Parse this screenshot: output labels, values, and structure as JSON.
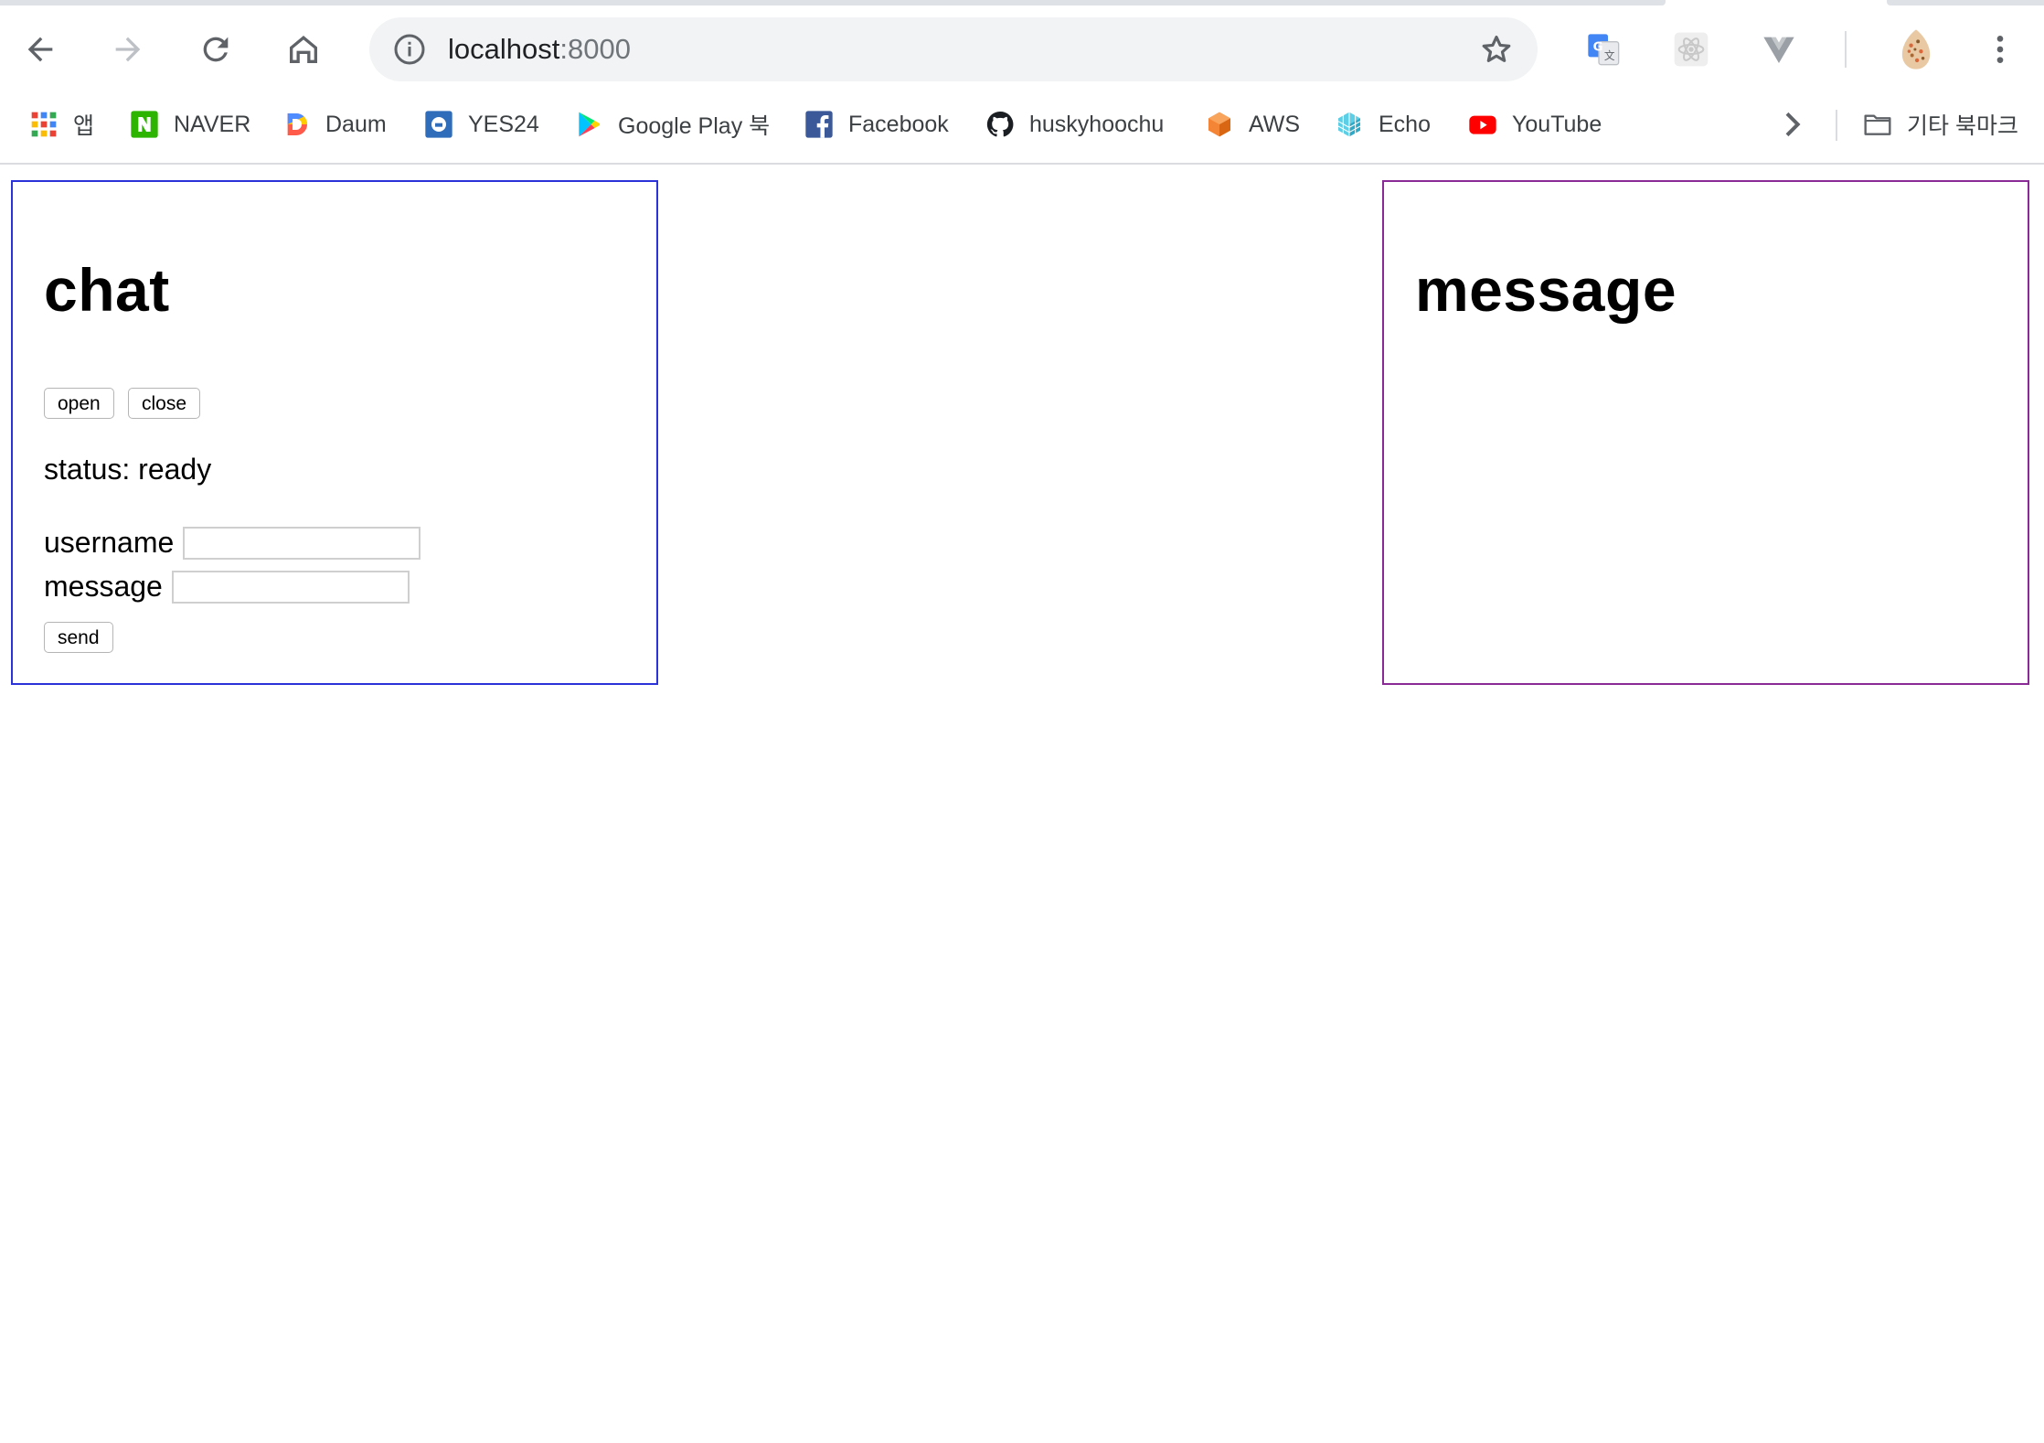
{
  "browser": {
    "url_host": "localhost",
    "url_port": ":8000",
    "bookmarks": [
      {
        "label": "앱",
        "icon": "apps-grid-icon"
      },
      {
        "label": "NAVER",
        "icon": "naver-icon"
      },
      {
        "label": "Daum",
        "icon": "daum-icon"
      },
      {
        "label": "YES24",
        "icon": "yes24-icon"
      },
      {
        "label": "Google Play 북",
        "icon": "google-play-icon"
      },
      {
        "label": "Facebook",
        "icon": "facebook-icon"
      },
      {
        "label": "huskyhoochu",
        "icon": "github-icon"
      },
      {
        "label": "AWS",
        "icon": "aws-icon"
      },
      {
        "label": "Echo",
        "icon": "echo-icon"
      },
      {
        "label": "YouTube",
        "icon": "youtube-icon"
      }
    ],
    "other_bookmarks": "기타 북마크"
  },
  "chat_panel": {
    "title": "chat",
    "open_label": "open",
    "close_label": "close",
    "status_text": "status: ready",
    "username_label": "username",
    "username_value": "",
    "message_label": "message",
    "message_value": "",
    "send_label": "send",
    "border_color": "#2b32d8"
  },
  "message_panel": {
    "title": "message",
    "border_color": "#8a2a96"
  }
}
